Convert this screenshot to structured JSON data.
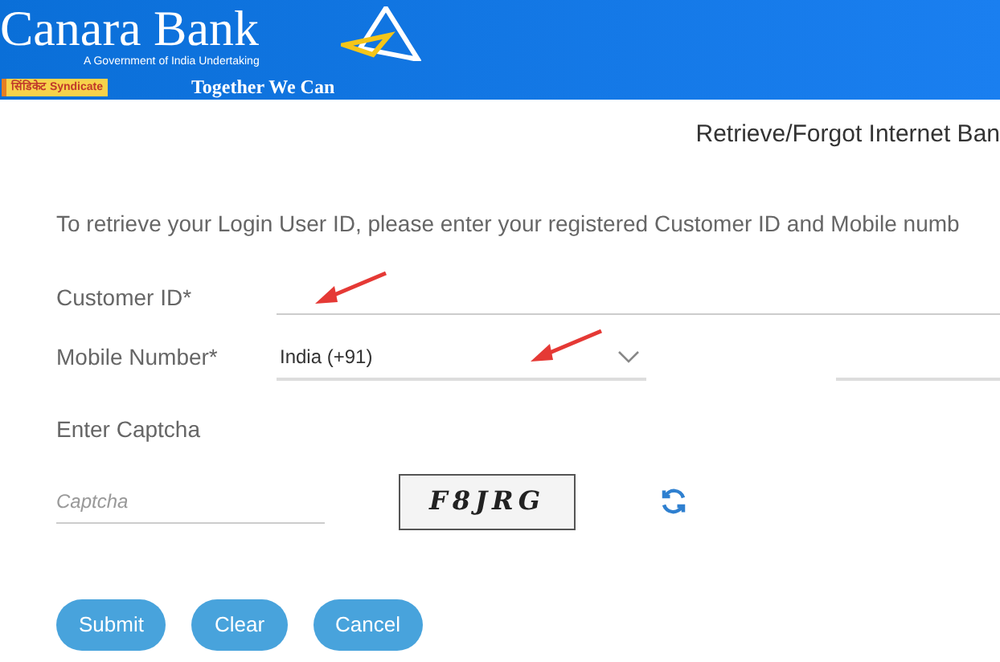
{
  "header": {
    "bank_name": "Canara Bank",
    "tagline_small": "A Government of India Undertaking",
    "badge": "सिंडिकेट Syndicate",
    "slogan": "Together We Can"
  },
  "title": "Retrieve/Forgot Internet Ban",
  "intro": "To retrieve your Login User ID, please enter your registered Customer ID and Mobile numb",
  "form": {
    "customer_id_label": "Customer ID*",
    "mobile_label": "Mobile Number*",
    "country": "India (+91)",
    "captcha_label": "Enter Captcha",
    "captcha_placeholder": "Captcha",
    "captcha_text": "F8JRG"
  },
  "buttons": [
    "Submit",
    "Clear",
    "Cancel"
  ]
}
